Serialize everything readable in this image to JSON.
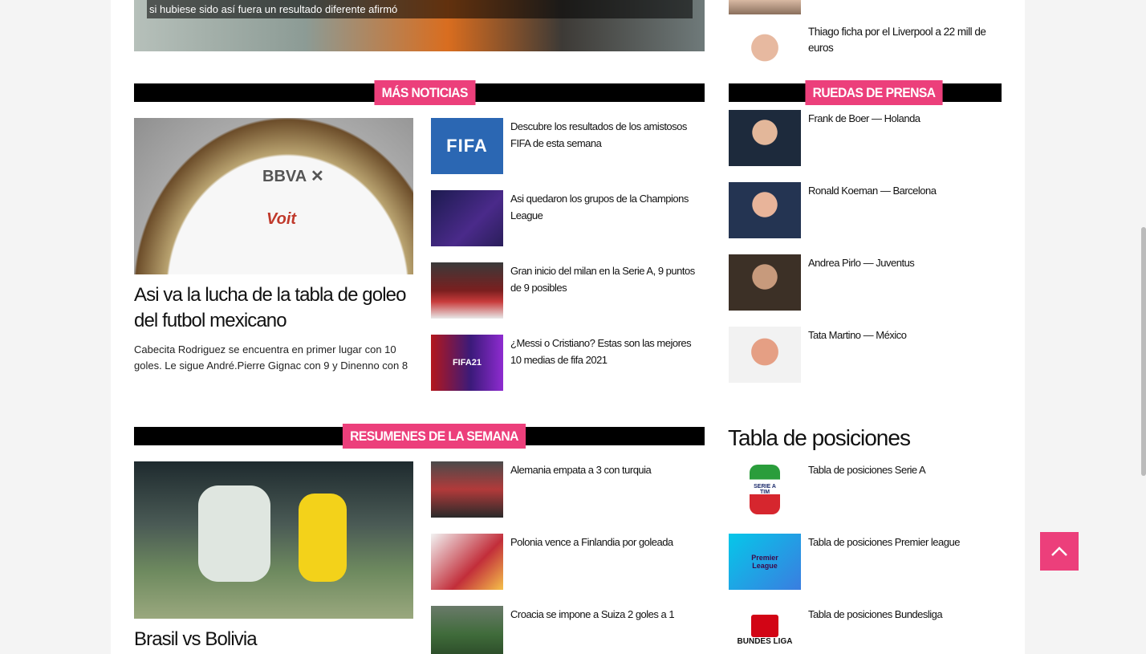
{
  "hero": {
    "caption": "si hubiese sido así fuera un resultado diferente afirmó"
  },
  "top_right_item": {
    "title": "Thiago ficha por el Liverpool a 22 mill de euros"
  },
  "mas_noticias": {
    "label": "MÁS NOTICIAS",
    "featured": {
      "title": "Asi va la lucha de la tabla de goleo del futbol mexicano",
      "excerpt": "Cabecita Rodriguez se encuentra en primer lugar con 10 goles. Le sigue André.Pierre Gignac con 9 y Dinenno con 8"
    },
    "items": [
      {
        "title": "Descubre los resultados de los amistosos FIFA de esta semana",
        "thumb_text": "FIFA"
      },
      {
        "title": "Asi quedaron los grupos de la Champions League"
      },
      {
        "title": "Gran inicio del milan en la Serie A, 9 puntos de 9 posibles"
      },
      {
        "title": "¿Messi o Cristiano? Estas son las mejores 10 medias de fifa 2021",
        "thumb_text": "FIFA21"
      }
    ]
  },
  "ruedas_de_prensa": {
    "label": "RUEDAS DE PRENSA",
    "items": [
      {
        "title": "Frank de Boer — Holanda"
      },
      {
        "title": "Ronald Koeman — Barcelona"
      },
      {
        "title": "Andrea Pirlo — Juventus"
      },
      {
        "title": "Tata Martino — México"
      }
    ]
  },
  "resumenes": {
    "label": "RESUMENES DE LA SEMANA",
    "featured": {
      "title": "Brasil vs Bolivia"
    },
    "items": [
      {
        "title": "Alemania empata a 3 con turquia"
      },
      {
        "title": "Polonia vence a Finlandia por goleada"
      },
      {
        "title": "Croacia se impone a Suiza 2 goles a 1"
      }
    ]
  },
  "tabla": {
    "heading": "Tabla de posiciones",
    "items": [
      {
        "title": "Tabla de posiciones Serie A",
        "logo_text": "SERIE A TIM"
      },
      {
        "title": "Tabla de posiciones Premier league",
        "logo_text": "Premier League"
      },
      {
        "title": "Tabla de posiciones Bundesliga",
        "logo_text": "BUNDES LIGA"
      }
    ]
  },
  "colors": {
    "accent": "#ec3f7b",
    "bar": "#000000"
  },
  "icons": {
    "scroll_top": "chevron-up-icon"
  }
}
